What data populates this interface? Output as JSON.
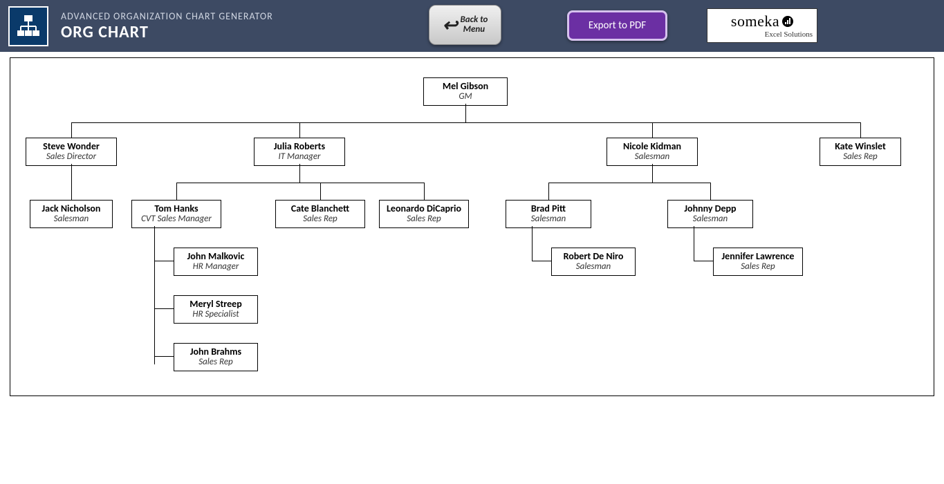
{
  "header": {
    "subtitle": "ADVANCED ORGANIZATION CHART GENERATOR",
    "title": "ORG CHART",
    "back_line1": "Back to",
    "back_line2": "Menu",
    "export_label": "Export to PDF",
    "brand_name": "someka",
    "brand_tagline": "Excel Solutions"
  },
  "nodes": {
    "n1": {
      "name": "Mel Gibson",
      "role": "GM"
    },
    "n2": {
      "name": "Steve Wonder",
      "role": "Sales Director"
    },
    "n3": {
      "name": "Julia Roberts",
      "role": "IT Manager"
    },
    "n4": {
      "name": "Nicole Kidman",
      "role": "Salesman"
    },
    "n5": {
      "name": "Kate Winslet",
      "role": "Sales Rep"
    },
    "n6": {
      "name": "Jack Nicholson",
      "role": "Salesman"
    },
    "n7": {
      "name": "Tom Hanks",
      "role": "CVT Sales Manager"
    },
    "n8": {
      "name": "Cate Blanchett",
      "role": "Sales Rep"
    },
    "n9": {
      "name": "Leonardo DiCaprio",
      "role": "Sales Rep"
    },
    "n10": {
      "name": "Brad Pitt",
      "role": "Salesman"
    },
    "n11": {
      "name": "Johnny Depp",
      "role": "Salesman"
    },
    "n12": {
      "name": "John Malkovic",
      "role": "HR Manager"
    },
    "n13": {
      "name": "Meryl Streep",
      "role": "HR Specialist"
    },
    "n14": {
      "name": "John Brahms",
      "role": "Sales Rep"
    },
    "n15": {
      "name": "Robert De Niro",
      "role": "Salesman"
    },
    "n16": {
      "name": "Jennifer Lawrence",
      "role": "Sales Rep"
    }
  },
  "chart_data": {
    "type": "org-tree",
    "tree": {
      "name": "Mel Gibson",
      "role": "GM",
      "children": [
        {
          "name": "Steve Wonder",
          "role": "Sales Director",
          "children": [
            {
              "name": "Jack Nicholson",
              "role": "Salesman"
            }
          ]
        },
        {
          "name": "Julia Roberts",
          "role": "IT Manager",
          "children": [
            {
              "name": "Tom Hanks",
              "role": "CVT Sales Manager",
              "children": [
                {
                  "name": "John Malkovic",
                  "role": "HR Manager"
                },
                {
                  "name": "Meryl Streep",
                  "role": "HR Specialist"
                },
                {
                  "name": "John Brahms",
                  "role": "Sales Rep"
                }
              ]
            },
            {
              "name": "Cate Blanchett",
              "role": "Sales Rep"
            },
            {
              "name": "Leonardo DiCaprio",
              "role": "Sales Rep"
            }
          ]
        },
        {
          "name": "Nicole Kidman",
          "role": "Salesman",
          "children": [
            {
              "name": "Brad Pitt",
              "role": "Salesman",
              "children": [
                {
                  "name": "Robert De Niro",
                  "role": "Salesman"
                }
              ]
            },
            {
              "name": "Johnny Depp",
              "role": "Salesman",
              "children": [
                {
                  "name": "Jennifer Lawrence",
                  "role": "Sales Rep"
                }
              ]
            }
          ]
        },
        {
          "name": "Kate Winslet",
          "role": "Sales Rep"
        }
      ]
    }
  }
}
